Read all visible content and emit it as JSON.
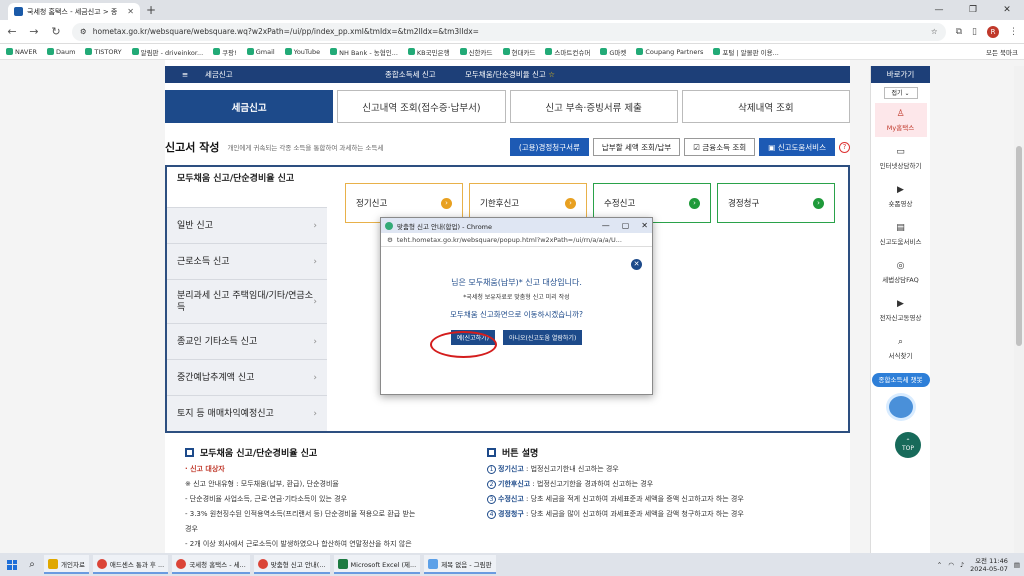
{
  "browser": {
    "tab_title": "국세청 홈택스 - 세금신고 > 종",
    "url": "hometax.go.kr/websquare/websquare.wq?w2xPath=/ui/pp/index_pp.xml&tmIdx=&tm2lIdx=&tm3lIdx="
  },
  "bookmarks": [
    "NAVER",
    "Daum",
    "TISTORY",
    "알림판 - driveinkor...",
    "쿠팡!",
    "Gmail",
    "YouTube",
    "NH Bank - 농협인...",
    "KB국민은행",
    "신한카드",
    "현대카드",
    "스마트컨슈머",
    "G마켓",
    "Coupang Partners",
    "포털 | 알몰판 이용..."
  ],
  "bookmarks_all": "모든 북마크",
  "topnav": {
    "section": "세금신고",
    "crumb1": "종합소득세 신고",
    "crumb2": "모두채움/단순경비율 신고"
  },
  "tabs": [
    "세금신고",
    "신고내역 조회(접수증·납부서)",
    "신고 부속·증빙서류 제출",
    "삭제내역 조회"
  ],
  "header": {
    "title": "신고서 작성",
    "subtitle": "개인에게 귀속되는 각종 소득을 통합하여 과세하는 소득세",
    "btn1": "(고용)경정청구서류",
    "btn2": "납부할 세액 조회/납부",
    "btn3": "금융소득 조회",
    "btn4": "신고도움서비스"
  },
  "sidemenu": {
    "head": "모두채움 신고/단순경비율 신고",
    "items": [
      "일반 신고",
      "근로소득 신고",
      "분리과세 신고 주택임대/기타/연금소득",
      "종교인 기타소득 신고",
      "중간예납추계액 신고",
      "토지 등 매매차익예정신고"
    ]
  },
  "cards": [
    "정기신고",
    "기한후신고",
    "수정신고",
    "경정청구"
  ],
  "left_section": {
    "title": "모두채움 신고/단순경비율 신고",
    "l1": "· 신고 대상자",
    "l2": "※ 신고 안내유형 : 모두채움(납부, 환급), 단순경비율",
    "l3": "- 단순경비율 사업소득, 근로·연금·기타소득이 있는 경우",
    "l4": "- 3.3% 원천징수된 인적용역소득(프리랜서 등) 단순경비율 적용으로 환급 받는",
    "l5": "경우",
    "l6": "- 2개 이상 회사에서 근로소득이 발생하였으나 합산하여 연말정산을 하지 않은"
  },
  "right_section": {
    "title": "버튼 설명",
    "items": [
      {
        "n": "1",
        "k": "정기신고",
        "v": " : 법정신고기한내 신고하는 경우"
      },
      {
        "n": "2",
        "k": "기한후신고",
        "v": " : 법정신고기한을 경과하여 신고하는 경우"
      },
      {
        "n": "3",
        "k": "수정신고",
        "v": " : 당초 세금을 적게 신고하여 과세표준과 세액을 증액 신고하고자 하는 경우"
      },
      {
        "n": "4",
        "k": "경정청구",
        "v": " : 당초 세금을 많이 신고하여 과세표준과 세액을 감액 청구하고자 하는 경우"
      }
    ]
  },
  "rside": {
    "head": "바로가기",
    "fold": "접기",
    "items": [
      "My홈택스",
      "인터넷상담하기",
      "숏폼영상",
      "신고도움서비스",
      "세법상담FAQ",
      "전자신고동영상",
      "서식찾기"
    ],
    "chatbot": "종합소득세 챗봇",
    "top": "TOP"
  },
  "popup": {
    "title": "맞춤형 신고 안내(합업) - Chrome",
    "url": "teht.hometax.go.kr/websquare/popup.html?w2xPath=/ui/rn/a/a/a/U...",
    "msg1": "님은 모두채움(납부)* 신고 대상입니다.",
    "msg2": "*국세청 보유자료로 맞춤형 신고 미리 작성",
    "msg3": "모두채움 신고화면으로 이동하시겠습니까?",
    "yes": "예(신고하기)",
    "no": "아니오(신고도움 열람하기)"
  },
  "taskbar": {
    "apps": [
      "개인자료",
      "애드센스 통과 후 ...",
      "국세청 홈택스 - 세...",
      "맞춤형 신고 안내(...",
      "Microsoft Excel (제...",
      "제목 없음 - 그림판"
    ],
    "time": "오전 11:46",
    "date": "2024-05-07"
  },
  "colors": {
    "navy": "#1d3f78",
    "accent_blue": "#1d4a8a",
    "highlight_ring": "#d41d1d"
  }
}
